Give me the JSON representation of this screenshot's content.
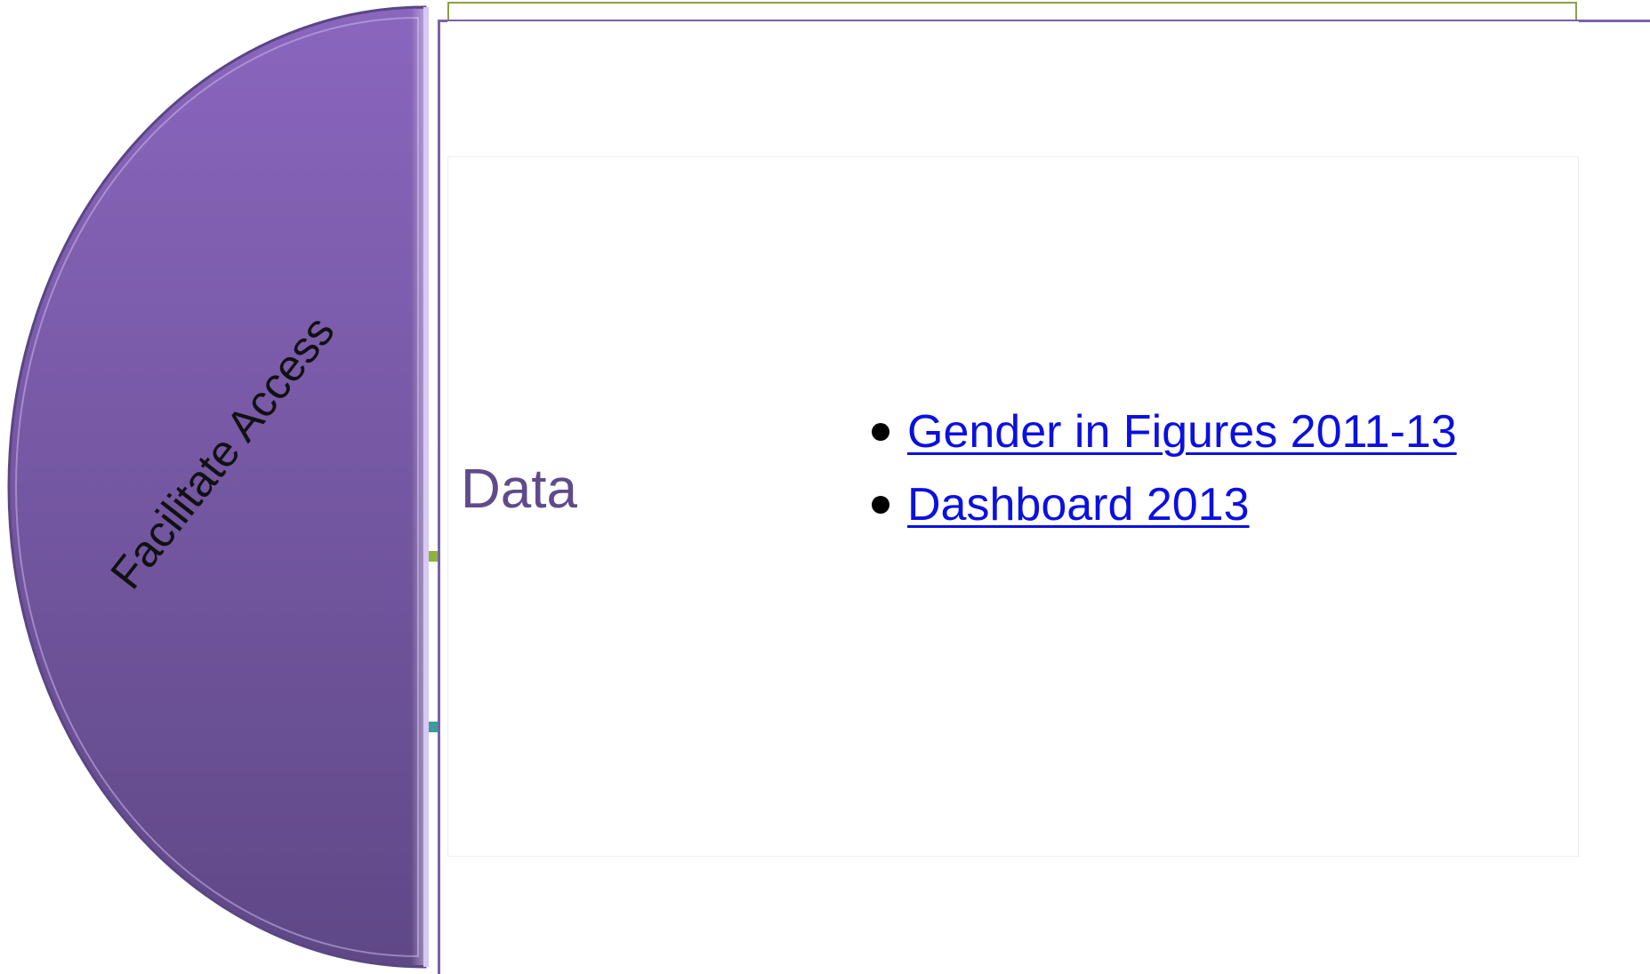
{
  "diagram": {
    "segment": {
      "label": "Facilitate Access",
      "color": "#7a5aa8"
    },
    "panel": {
      "heading": "Data",
      "links": [
        {
          "label": "Gender in Figures 2011-13"
        },
        {
          "label": "Dashboard 2013"
        }
      ]
    },
    "colors": {
      "link": "#0b10e0",
      "heading": "#5f4b8b",
      "accent_green": "#8db33c",
      "accent_teal": "#3c9c9c",
      "panel_border": "#7a62a8"
    }
  }
}
